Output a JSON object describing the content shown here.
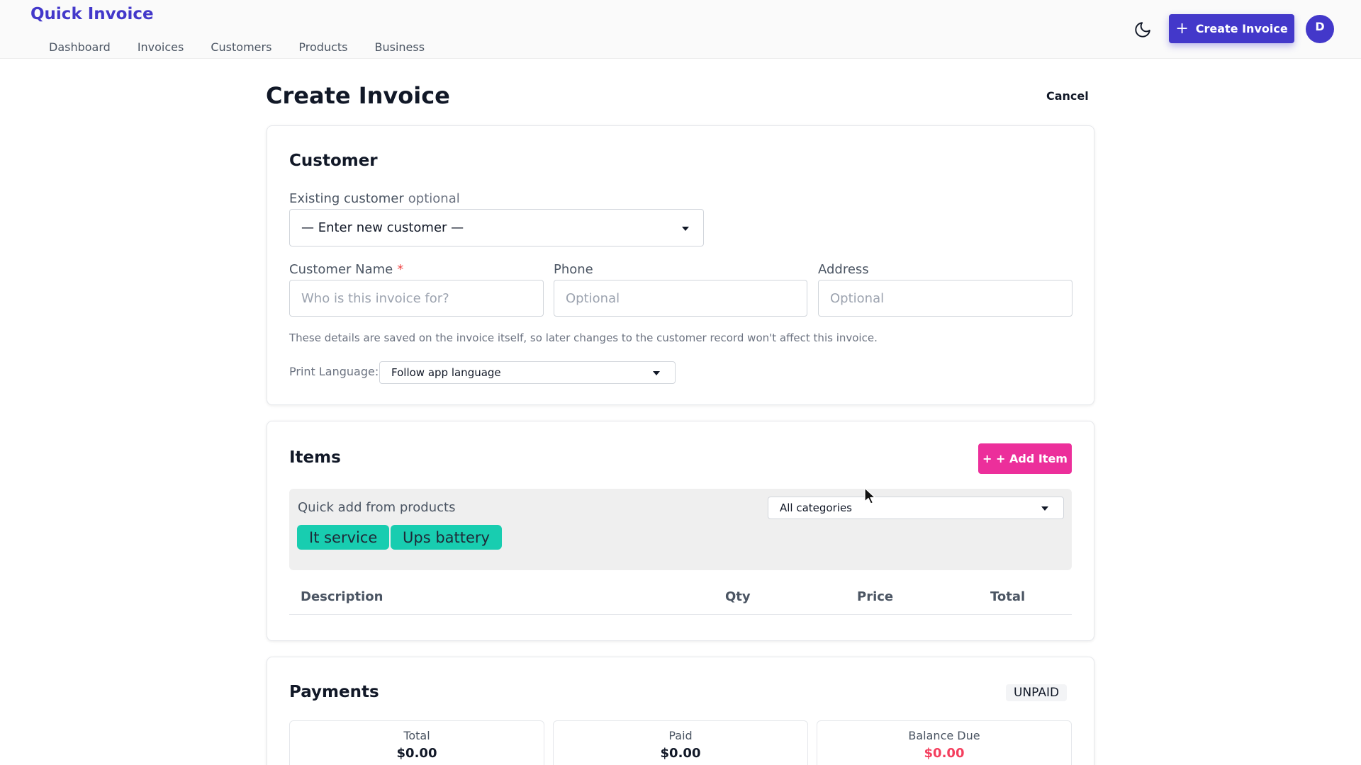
{
  "header": {
    "brand": "Quick Invoice",
    "nav": [
      "Dashboard",
      "Invoices",
      "Customers",
      "Products",
      "Business"
    ],
    "create_button": "Create Invoice",
    "avatar_initial": "D"
  },
  "page": {
    "title": "Create Invoice",
    "cancel": "Cancel"
  },
  "customer": {
    "title": "Customer",
    "existing_label": "Existing customer",
    "existing_optional": "optional",
    "existing_value": "— Enter new customer —",
    "name_label": "Customer Name",
    "name_required": "*",
    "name_placeholder": "Who is this invoice for?",
    "phone_label": "Phone",
    "phone_placeholder": "Optional",
    "address_label": "Address",
    "address_placeholder": "Optional",
    "helper": "These details are saved on the invoice itself, so later changes to the customer record won't affect this invoice.",
    "print_language_label": "Print Language:",
    "print_language_value": "Follow app language"
  },
  "items": {
    "title": "Items",
    "add_button": "+ + Add Item",
    "quick_add_label": "Quick add from products",
    "category_value": "All categories",
    "chips": [
      "It service",
      "Ups battery"
    ],
    "columns": {
      "description": "Description",
      "qty": "Qty",
      "price": "Price",
      "total": "Total"
    }
  },
  "payments": {
    "title": "Payments",
    "status": "UNPAID",
    "summary": {
      "total_label": "Total",
      "total_value": "$0.00",
      "paid_label": "Paid",
      "paid_value": "$0.00",
      "due_label": "Balance Due",
      "due_value": "$0.00"
    }
  },
  "colors": {
    "brand": "#4338ca",
    "add_item": "#ec2f9b",
    "chip": "#18cdb0",
    "balance_due": "#f43f5e"
  },
  "icons": {
    "theme_toggle": "moon-icon",
    "create": "plus-icon",
    "dropdown": "caret-down-icon",
    "pointer": "mouse-cursor"
  }
}
